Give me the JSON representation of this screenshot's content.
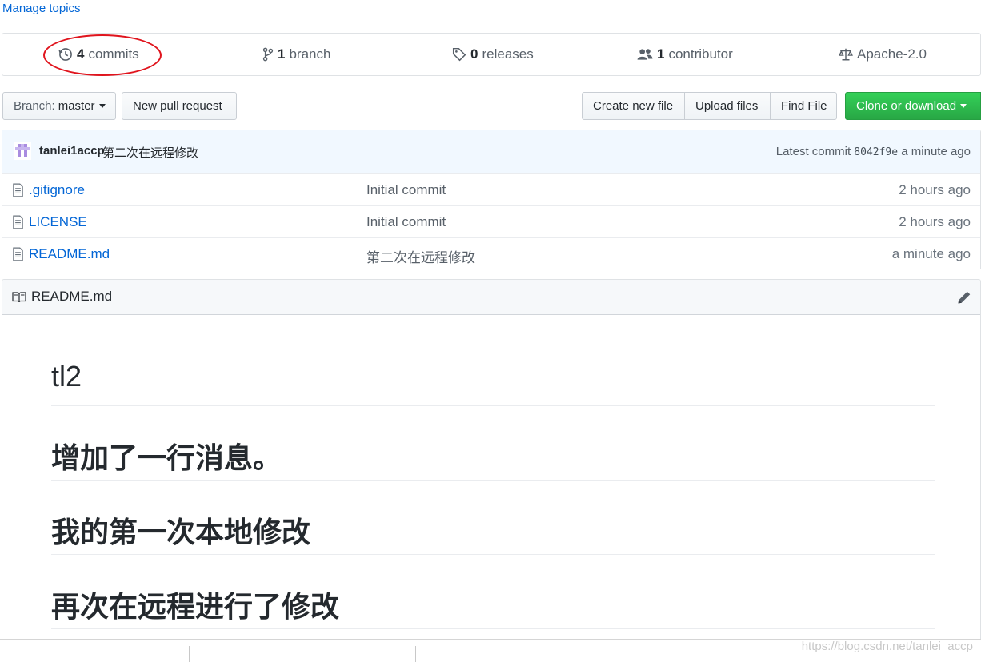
{
  "topics": {
    "manage_label": "Manage topics"
  },
  "summary": {
    "commits": {
      "count": "4",
      "label": "commits"
    },
    "branches": {
      "count": "1",
      "label": "branch"
    },
    "releases": {
      "count": "0",
      "label": "releases"
    },
    "contributors": {
      "count": "1",
      "label": "contributor"
    },
    "license": {
      "label": "Apache-2.0"
    }
  },
  "toolbar": {
    "branch_prefix": "Branch:",
    "branch_name": "master",
    "new_pr": "New pull request",
    "create_file": "Create new file",
    "upload_files": "Upload files",
    "find_file": "Find File",
    "clone": "Clone or download"
  },
  "latest_commit": {
    "author": "tanlei1accp",
    "message": "第二次在远程修改",
    "prefix": "Latest commit",
    "sha": "8042f9e",
    "time": "a minute ago"
  },
  "files": [
    {
      "name": ".gitignore",
      "message": "Initial commit",
      "age": "2 hours ago"
    },
    {
      "name": "LICENSE",
      "message": "Initial commit",
      "age": "2 hours ago"
    },
    {
      "name": "README.md",
      "message": "第二次在远程修改",
      "age": "a minute ago"
    }
  ],
  "readme": {
    "title": "README.md",
    "headings": [
      "tl2",
      "增加了一行消息。",
      "我的第一次本地修改",
      "再次在远程进行了修改"
    ]
  },
  "watermark": "https://blog.csdn.net/tanlei_accp",
  "colors": {
    "link": "#0366d6",
    "green": "#28a745",
    "annotation": "#e0141d"
  }
}
